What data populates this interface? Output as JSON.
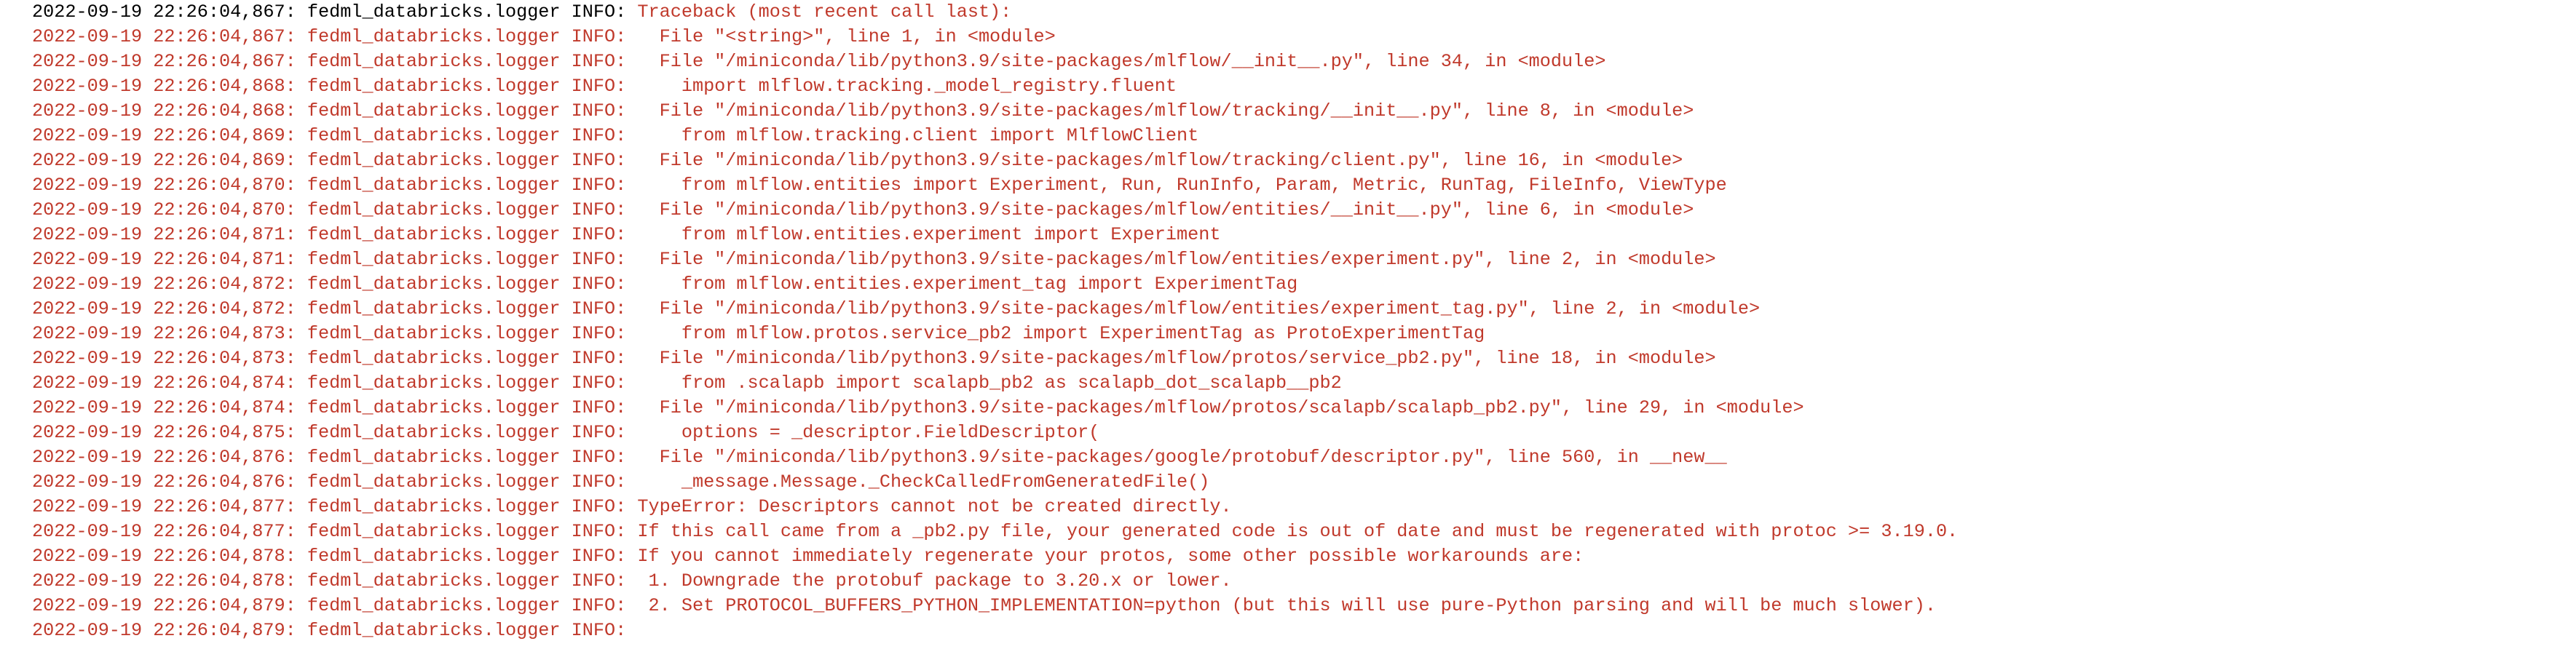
{
  "colors": {
    "background": "#ffffff",
    "error_text": "#c0392b",
    "default_text": "#000000"
  },
  "log": {
    "lines": [
      {
        "timestamp": "2022-09-19 22:26:04,867:",
        "logger": "fedml_databricks.logger",
        "level": "INFO:",
        "message": "Traceback (most recent call last):"
      },
      {
        "timestamp": "2022-09-19 22:26:04,867:",
        "logger": "fedml_databricks.logger",
        "level": "INFO:",
        "message": "  File \"<string>\", line 1, in <module>"
      },
      {
        "timestamp": "2022-09-19 22:26:04,867:",
        "logger": "fedml_databricks.logger",
        "level": "INFO:",
        "message": "  File \"/miniconda/lib/python3.9/site-packages/mlflow/__init__.py\", line 34, in <module>"
      },
      {
        "timestamp": "2022-09-19 22:26:04,868:",
        "logger": "fedml_databricks.logger",
        "level": "INFO:",
        "message": "    import mlflow.tracking._model_registry.fluent"
      },
      {
        "timestamp": "2022-09-19 22:26:04,868:",
        "logger": "fedml_databricks.logger",
        "level": "INFO:",
        "message": "  File \"/miniconda/lib/python3.9/site-packages/mlflow/tracking/__init__.py\", line 8, in <module>"
      },
      {
        "timestamp": "2022-09-19 22:26:04,869:",
        "logger": "fedml_databricks.logger",
        "level": "INFO:",
        "message": "    from mlflow.tracking.client import MlflowClient"
      },
      {
        "timestamp": "2022-09-19 22:26:04,869:",
        "logger": "fedml_databricks.logger",
        "level": "INFO:",
        "message": "  File \"/miniconda/lib/python3.9/site-packages/mlflow/tracking/client.py\", line 16, in <module>"
      },
      {
        "timestamp": "2022-09-19 22:26:04,870:",
        "logger": "fedml_databricks.logger",
        "level": "INFO:",
        "message": "    from mlflow.entities import Experiment, Run, RunInfo, Param, Metric, RunTag, FileInfo, ViewType"
      },
      {
        "timestamp": "2022-09-19 22:26:04,870:",
        "logger": "fedml_databricks.logger",
        "level": "INFO:",
        "message": "  File \"/miniconda/lib/python3.9/site-packages/mlflow/entities/__init__.py\", line 6, in <module>"
      },
      {
        "timestamp": "2022-09-19 22:26:04,871:",
        "logger": "fedml_databricks.logger",
        "level": "INFO:",
        "message": "    from mlflow.entities.experiment import Experiment"
      },
      {
        "timestamp": "2022-09-19 22:26:04,871:",
        "logger": "fedml_databricks.logger",
        "level": "INFO:",
        "message": "  File \"/miniconda/lib/python3.9/site-packages/mlflow/entities/experiment.py\", line 2, in <module>"
      },
      {
        "timestamp": "2022-09-19 22:26:04,872:",
        "logger": "fedml_databricks.logger",
        "level": "INFO:",
        "message": "    from mlflow.entities.experiment_tag import ExperimentTag"
      },
      {
        "timestamp": "2022-09-19 22:26:04,872:",
        "logger": "fedml_databricks.logger",
        "level": "INFO:",
        "message": "  File \"/miniconda/lib/python3.9/site-packages/mlflow/entities/experiment_tag.py\", line 2, in <module>"
      },
      {
        "timestamp": "2022-09-19 22:26:04,873:",
        "logger": "fedml_databricks.logger",
        "level": "INFO:",
        "message": "    from mlflow.protos.service_pb2 import ExperimentTag as ProtoExperimentTag"
      },
      {
        "timestamp": "2022-09-19 22:26:04,873:",
        "logger": "fedml_databricks.logger",
        "level": "INFO:",
        "message": "  File \"/miniconda/lib/python3.9/site-packages/mlflow/protos/service_pb2.py\", line 18, in <module>"
      },
      {
        "timestamp": "2022-09-19 22:26:04,874:",
        "logger": "fedml_databricks.logger",
        "level": "INFO:",
        "message": "    from .scalapb import scalapb_pb2 as scalapb_dot_scalapb__pb2"
      },
      {
        "timestamp": "2022-09-19 22:26:04,874:",
        "logger": "fedml_databricks.logger",
        "level": "INFO:",
        "message": "  File \"/miniconda/lib/python3.9/site-packages/mlflow/protos/scalapb/scalapb_pb2.py\", line 29, in <module>"
      },
      {
        "timestamp": "2022-09-19 22:26:04,875:",
        "logger": "fedml_databricks.logger",
        "level": "INFO:",
        "message": "    options = _descriptor.FieldDescriptor("
      },
      {
        "timestamp": "2022-09-19 22:26:04,876:",
        "logger": "fedml_databricks.logger",
        "level": "INFO:",
        "message": "  File \"/miniconda/lib/python3.9/site-packages/google/protobuf/descriptor.py\", line 560, in __new__"
      },
      {
        "timestamp": "2022-09-19 22:26:04,876:",
        "logger": "fedml_databricks.logger",
        "level": "INFO:",
        "message": "    _message.Message._CheckCalledFromGeneratedFile()"
      },
      {
        "timestamp": "2022-09-19 22:26:04,877:",
        "logger": "fedml_databricks.logger",
        "level": "INFO:",
        "message": "TypeError: Descriptors cannot not be created directly."
      },
      {
        "timestamp": "2022-09-19 22:26:04,877:",
        "logger": "fedml_databricks.logger",
        "level": "INFO:",
        "message": "If this call came from a _pb2.py file, your generated code is out of date and must be regenerated with protoc >= 3.19.0."
      },
      {
        "timestamp": "2022-09-19 22:26:04,878:",
        "logger": "fedml_databricks.logger",
        "level": "INFO:",
        "message": "If you cannot immediately regenerate your protos, some other possible workarounds are:"
      },
      {
        "timestamp": "2022-09-19 22:26:04,878:",
        "logger": "fedml_databricks.logger",
        "level": "INFO:",
        "message": " 1. Downgrade the protobuf package to 3.20.x or lower."
      },
      {
        "timestamp": "2022-09-19 22:26:04,879:",
        "logger": "fedml_databricks.logger",
        "level": "INFO:",
        "message": " 2. Set PROTOCOL_BUFFERS_PYTHON_IMPLEMENTATION=python (but this will use pure-Python parsing and will be much slower)."
      },
      {
        "timestamp": "2022-09-19 22:26:04,879:",
        "logger": "fedml_databricks.logger",
        "level": "INFO:",
        "message": ""
      }
    ]
  }
}
